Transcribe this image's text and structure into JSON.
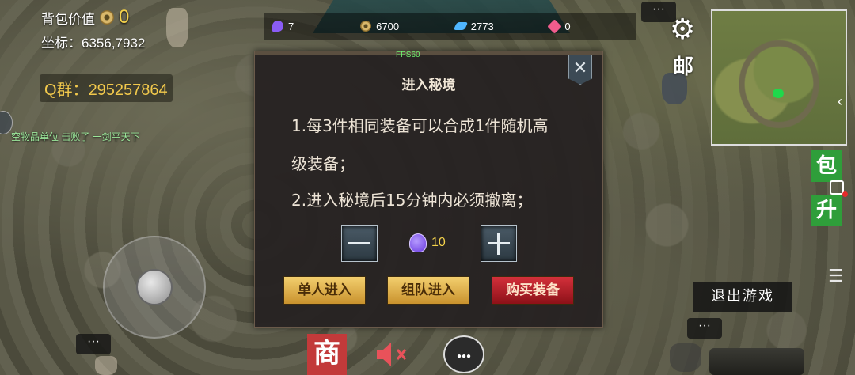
{
  "hud": {
    "bag_value_label": "背包价值",
    "bag_value": "0",
    "coords_label": "坐标：",
    "coords_value": "6356,7932",
    "qq_label": "Q群：",
    "qq_value": "295257864",
    "kill_log": "空物品单位 击败了 一剑平天下"
  },
  "currencies": [
    {
      "icon": "purple-gem-icon",
      "value": "7"
    },
    {
      "icon": "coin-icon",
      "value": "6700"
    },
    {
      "icon": "blue-crystal-icon",
      "value": "2773"
    },
    {
      "icon": "red-gem-icon",
      "value": "0"
    }
  ],
  "fps": "FPS60",
  "dialog": {
    "title": "进入秘境",
    "rule1_line1": "1.每3件相同装备可以合成1件随机高",
    "rule1_line2": "级装备；",
    "rule2": "2.进入秘境后15分钟内必须撤离；",
    "close": "✕",
    "quantity": "10",
    "buttons": {
      "solo": "单人进入",
      "team": "组队进入",
      "buy": "购买装备"
    }
  },
  "right": {
    "mail": "邮",
    "bag": "包",
    "upgrade": "升",
    "exit": "退出游戏",
    "menu": "☰",
    "map_toggle": "‹"
  },
  "bottom": {
    "shop": "商",
    "more": "···",
    "chat": "●●●"
  }
}
